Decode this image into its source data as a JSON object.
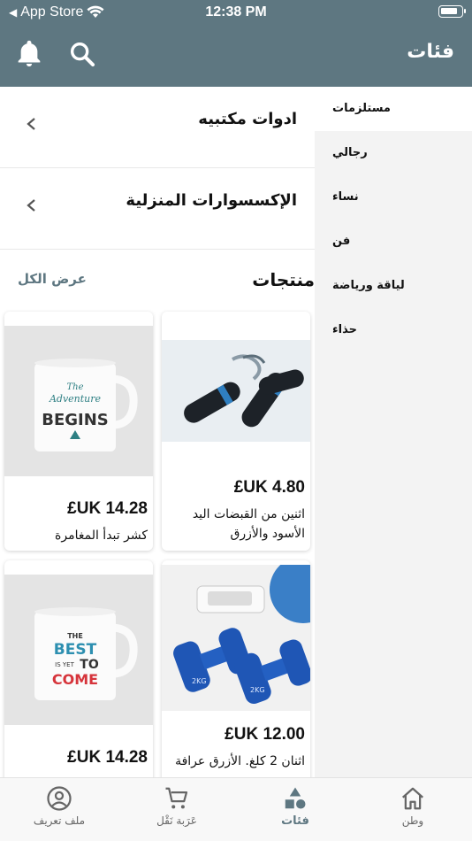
{
  "status_bar": {
    "carrier": "App Store",
    "time": "12:38 PM"
  },
  "header": {
    "title": "فئات",
    "icons": [
      "bell-icon",
      "search-icon"
    ]
  },
  "subcategories": [
    {
      "label": "ادوات مكتبيه"
    },
    {
      "label": "الإكسسوارات المنزلية"
    }
  ],
  "products_section": {
    "title": "منتجات",
    "see_all": "عرض الكل"
  },
  "products": [
    {
      "name": "اثنين من القبضات اليد الأسود والأزرق",
      "price": "£UK 4.80"
    },
    {
      "name": "كشر تبدأ المغامرة",
      "price": "£UK 14.28",
      "mug_text": [
        "The",
        "Adventure",
        "BEGINS"
      ]
    },
    {
      "name": "اثنان 2 كلغ. الأزرق عرافة",
      "price": "£UK 12.00",
      "dumbbell_text": "2KG"
    },
    {
      "name": "",
      "price": "£UK 14.28",
      "mug_text": [
        "THE",
        "BEST",
        "IS YET",
        "TO",
        "COME"
      ]
    }
  ],
  "sidebar": {
    "items": [
      {
        "label": "مستلزمات",
        "active": true
      },
      {
        "label": "رجالي",
        "active": false
      },
      {
        "label": "نساء",
        "active": false
      },
      {
        "label": "فن",
        "active": false
      },
      {
        "label": "لياقة ورياضة",
        "active": false
      },
      {
        "label": "حذاء",
        "active": false
      }
    ]
  },
  "tabbar": {
    "tabs": [
      {
        "label": "ملف تعريف",
        "icon": "profile-icon",
        "active": false
      },
      {
        "label": "عَرَبة نَقْل",
        "icon": "cart-icon",
        "active": false
      },
      {
        "label": "فئات",
        "icon": "categories-icon",
        "active": true
      },
      {
        "label": "وطن",
        "icon": "home-icon",
        "active": false
      }
    ]
  },
  "colors": {
    "header": "#5e7781",
    "sidebar": "#f3f3f3",
    "accent": "#5e7781"
  }
}
